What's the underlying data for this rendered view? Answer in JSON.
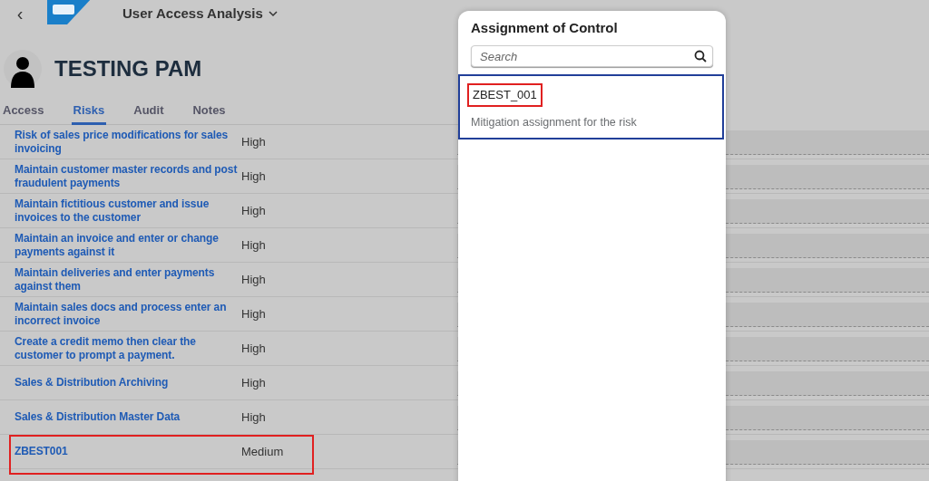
{
  "header": {
    "back": "‹",
    "app_title": "User Access Analysis"
  },
  "user": {
    "name": "TESTING PAM"
  },
  "tabs": [
    {
      "label": "Access",
      "selected": false
    },
    {
      "label": "Risks",
      "selected": true
    },
    {
      "label": "Audit",
      "selected": false
    },
    {
      "label": "Notes",
      "selected": false
    }
  ],
  "risks": [
    {
      "name": "Risk of sales price modifications for sales invoicing",
      "level": "High",
      "highlighted": false
    },
    {
      "name": "Maintain customer master records and post fraudulent payments",
      "level": "High",
      "highlighted": false
    },
    {
      "name": "Maintain fictitious customer and issue invoices to the customer",
      "level": "High",
      "highlighted": false
    },
    {
      "name": "Maintain an invoice and enter or change payments against it",
      "level": "High",
      "highlighted": false
    },
    {
      "name": "Maintain deliveries and enter payments against them",
      "level": "High",
      "highlighted": false
    },
    {
      "name": "Maintain sales docs and process enter an incorrect invoice",
      "level": "High",
      "highlighted": false
    },
    {
      "name": "Create a credit memo then clear the customer to prompt a payment.",
      "level": "High",
      "highlighted": false
    },
    {
      "name": "Sales & Distribution Archiving",
      "level": "High",
      "highlighted": false
    },
    {
      "name": "Sales & Distribution Master Data",
      "level": "High",
      "highlighted": false
    },
    {
      "name": "ZBEST001",
      "level": "Medium",
      "highlighted": true
    }
  ],
  "dialog": {
    "title": "Assignment of Control",
    "search": {
      "placeholder": "Search"
    },
    "items": [
      {
        "title": "ZBEST_001",
        "description": "Mitigation assignment for the risk",
        "selected": true,
        "highlighted": true
      }
    ]
  }
}
